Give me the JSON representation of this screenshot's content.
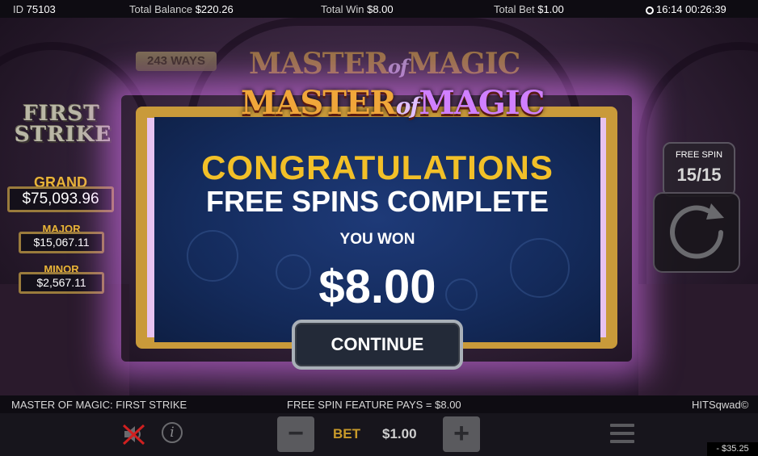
{
  "topbar": {
    "id_label": "ID",
    "id_value": "75103",
    "balance_label": "Total Balance",
    "balance_value": "$220.26",
    "win_label": "Total Win",
    "win_value": "$8.00",
    "bet_label": "Total Bet",
    "bet_value": "$1.00",
    "clock_icon": "clock-icon",
    "time": "16:14",
    "session": "00:26:39"
  },
  "game": {
    "ways": "243 WAYS",
    "first_strike_line1": "FIRST",
    "first_strike_line2": "STRIKE",
    "logo_back": {
      "a": "MASTER",
      "b": "of",
      "c": "MAGIC"
    },
    "logo_front": {
      "a": "MASTER",
      "b": "of",
      "c": "MAGIC"
    }
  },
  "jackpots": {
    "grand_label": "GRAND",
    "grand_value": "$75,093.96",
    "major_label": "MAJOR",
    "major_value": "$15,067.11",
    "minor_label": "MINOR",
    "minor_value": "$2,567.11"
  },
  "dialog": {
    "congrats": "CONGRATULATIONS",
    "complete": "FREE SPINS COMPLETE",
    "you_won": "YOU WON",
    "amount": "$8.00",
    "continue_label": "CONTINUE"
  },
  "free_spin": {
    "label": "FREE SPIN",
    "count": "15/15",
    "spin_icon": "spin-icon"
  },
  "infobar": {
    "game_name": "MASTER OF MAGIC: FIRST STRIKE",
    "feature_pays": "FREE SPIN FEATURE PAYS = $8.00",
    "brand": "HITSqwad©"
  },
  "controls": {
    "minus": "−",
    "bet_label": "BET",
    "bet_value": "$1.00",
    "plus": "+",
    "corner_balance": "- $35.25",
    "sound_icon": "sound-muted-icon",
    "info_icon": "info-icon",
    "menu_icon": "menu-icon",
    "info_glyph": "i"
  },
  "colors": {
    "gold": "#f2c028",
    "panel_blue": "#142b5c",
    "frame_gold": "#c99a3a",
    "glow_pink": "#e678ff",
    "bet_gold": "#c89a2a"
  }
}
